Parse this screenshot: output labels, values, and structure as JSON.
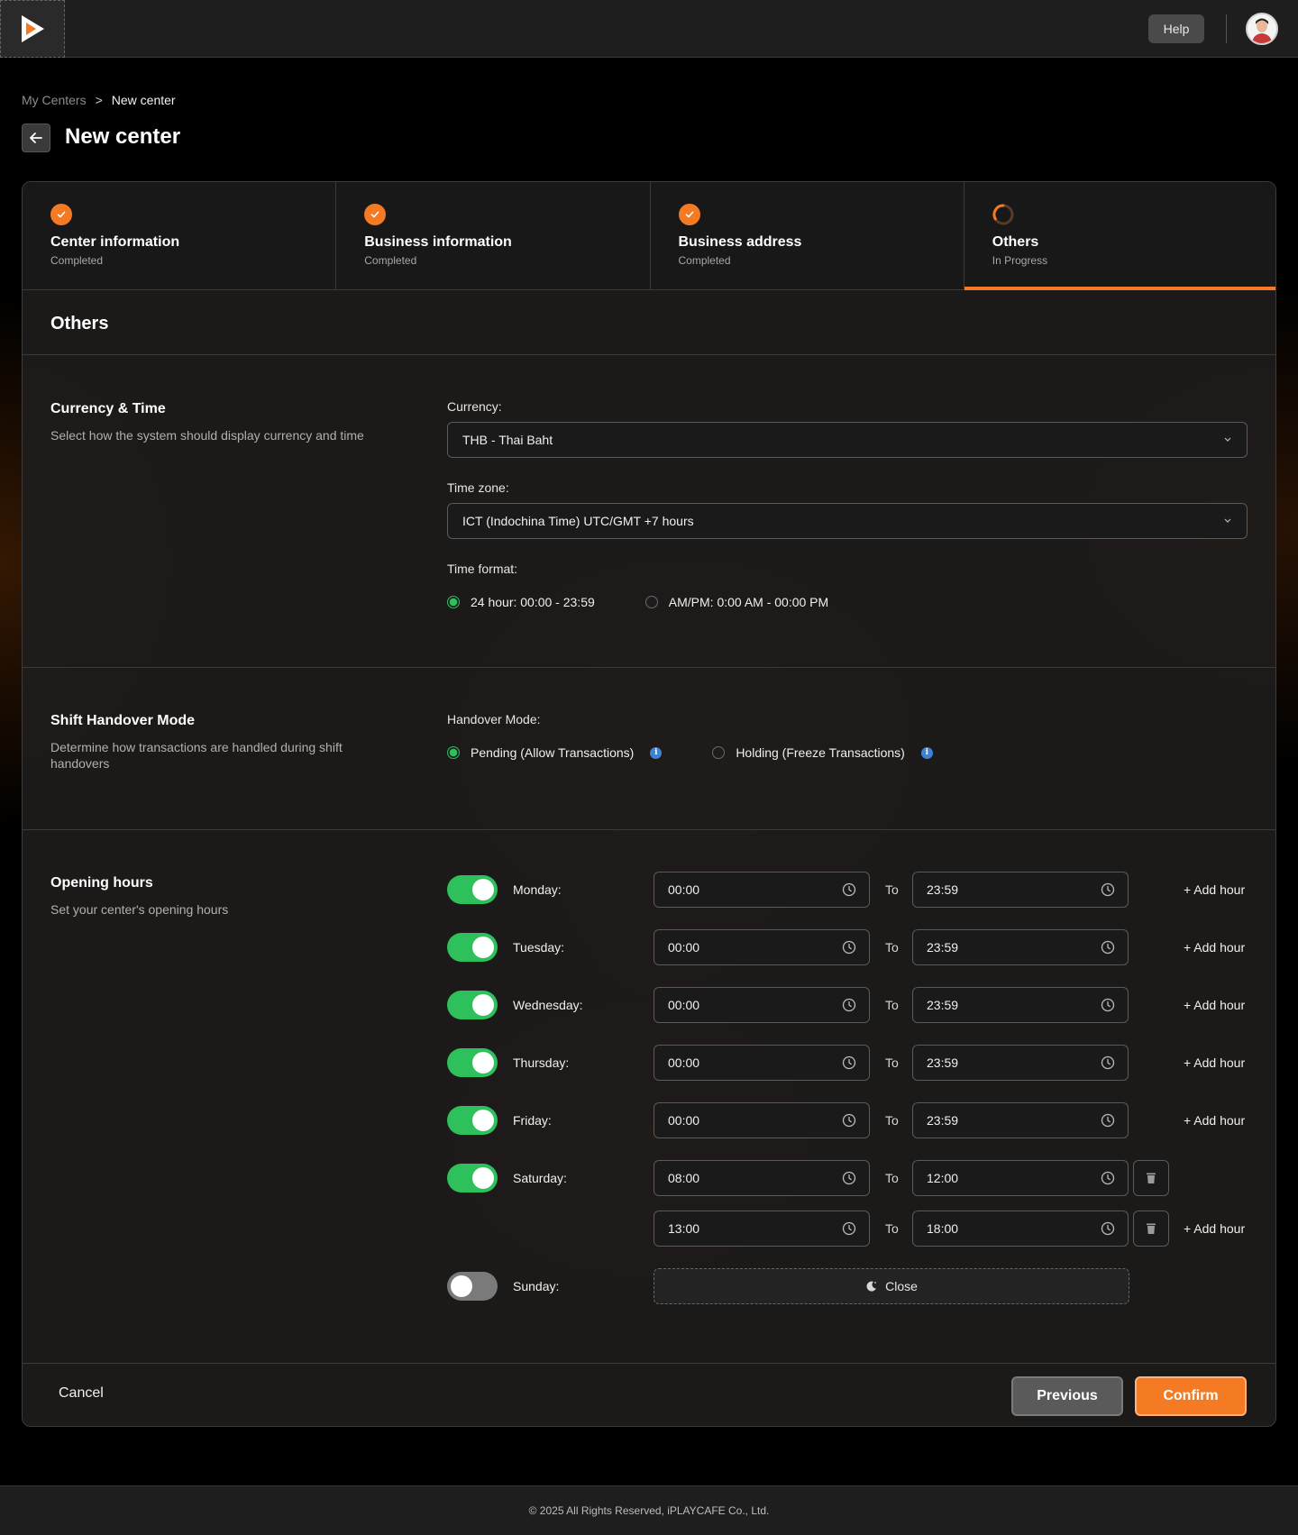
{
  "topbar": {
    "help_label": "Help"
  },
  "breadcrumb": {
    "parent": "My Centers",
    "separator": ">",
    "current": "New center"
  },
  "page_title": "New center",
  "steps": [
    {
      "title": "Center information",
      "status": "Completed",
      "state": "done"
    },
    {
      "title": "Business information",
      "status": "Completed",
      "state": "done"
    },
    {
      "title": "Business address",
      "status": "Completed",
      "state": "done"
    },
    {
      "title": "Others",
      "status": "In Progress",
      "state": "active"
    }
  ],
  "section_title": "Others",
  "currency_time": {
    "title": "Currency & Time",
    "description": "Select how the system should display currency and time",
    "currency_label": "Currency:",
    "currency_value": "THB - Thai Baht",
    "timezone_label": "Time zone:",
    "timezone_value": "ICT (Indochina Time) UTC/GMT +7 hours",
    "time_format_label": "Time format:",
    "time_format_options": [
      "24 hour: 00:00 - 23:59",
      "AM/PM: 0:00 AM - 00:00 PM"
    ],
    "time_format_selected": 0
  },
  "handover": {
    "title": "Shift Handover Mode",
    "description": "Determine how transactions are handled during shift handovers",
    "mode_label": "Handover Mode:",
    "options": [
      "Pending (Allow Transactions)",
      "Holding (Freeze Transactions)"
    ],
    "selected": 0
  },
  "opening_hours": {
    "title": "Opening hours",
    "description": "Set your center's opening hours",
    "to_label": "To",
    "add_hour_label": "+ Add hour",
    "closed_label": "Close",
    "days": [
      {
        "day": "Monday:",
        "enabled": true,
        "ranges": [
          [
            "00:00",
            "23:59"
          ]
        ]
      },
      {
        "day": "Tuesday:",
        "enabled": true,
        "ranges": [
          [
            "00:00",
            "23:59"
          ]
        ]
      },
      {
        "day": "Wednesday:",
        "enabled": true,
        "ranges": [
          [
            "00:00",
            "23:59"
          ]
        ]
      },
      {
        "day": "Thursday:",
        "enabled": true,
        "ranges": [
          [
            "00:00",
            "23:59"
          ]
        ]
      },
      {
        "day": "Friday:",
        "enabled": true,
        "ranges": [
          [
            "00:00",
            "23:59"
          ]
        ]
      },
      {
        "day": "Saturday:",
        "enabled": true,
        "ranges": [
          [
            "08:00",
            "12:00"
          ],
          [
            "13:00",
            "18:00"
          ]
        ]
      },
      {
        "day": "Sunday:",
        "enabled": false,
        "ranges": []
      }
    ]
  },
  "footer_actions": {
    "cancel": "Cancel",
    "previous": "Previous",
    "confirm": "Confirm"
  },
  "copyright": "© 2025 All Rights Reserved, iPLAYCAFE Co., Ltd.",
  "colors": {
    "accent": "#f47a24",
    "toggle_on": "#2ec05a",
    "radio_on": "#2ec05a",
    "info": "#3c83d6"
  }
}
